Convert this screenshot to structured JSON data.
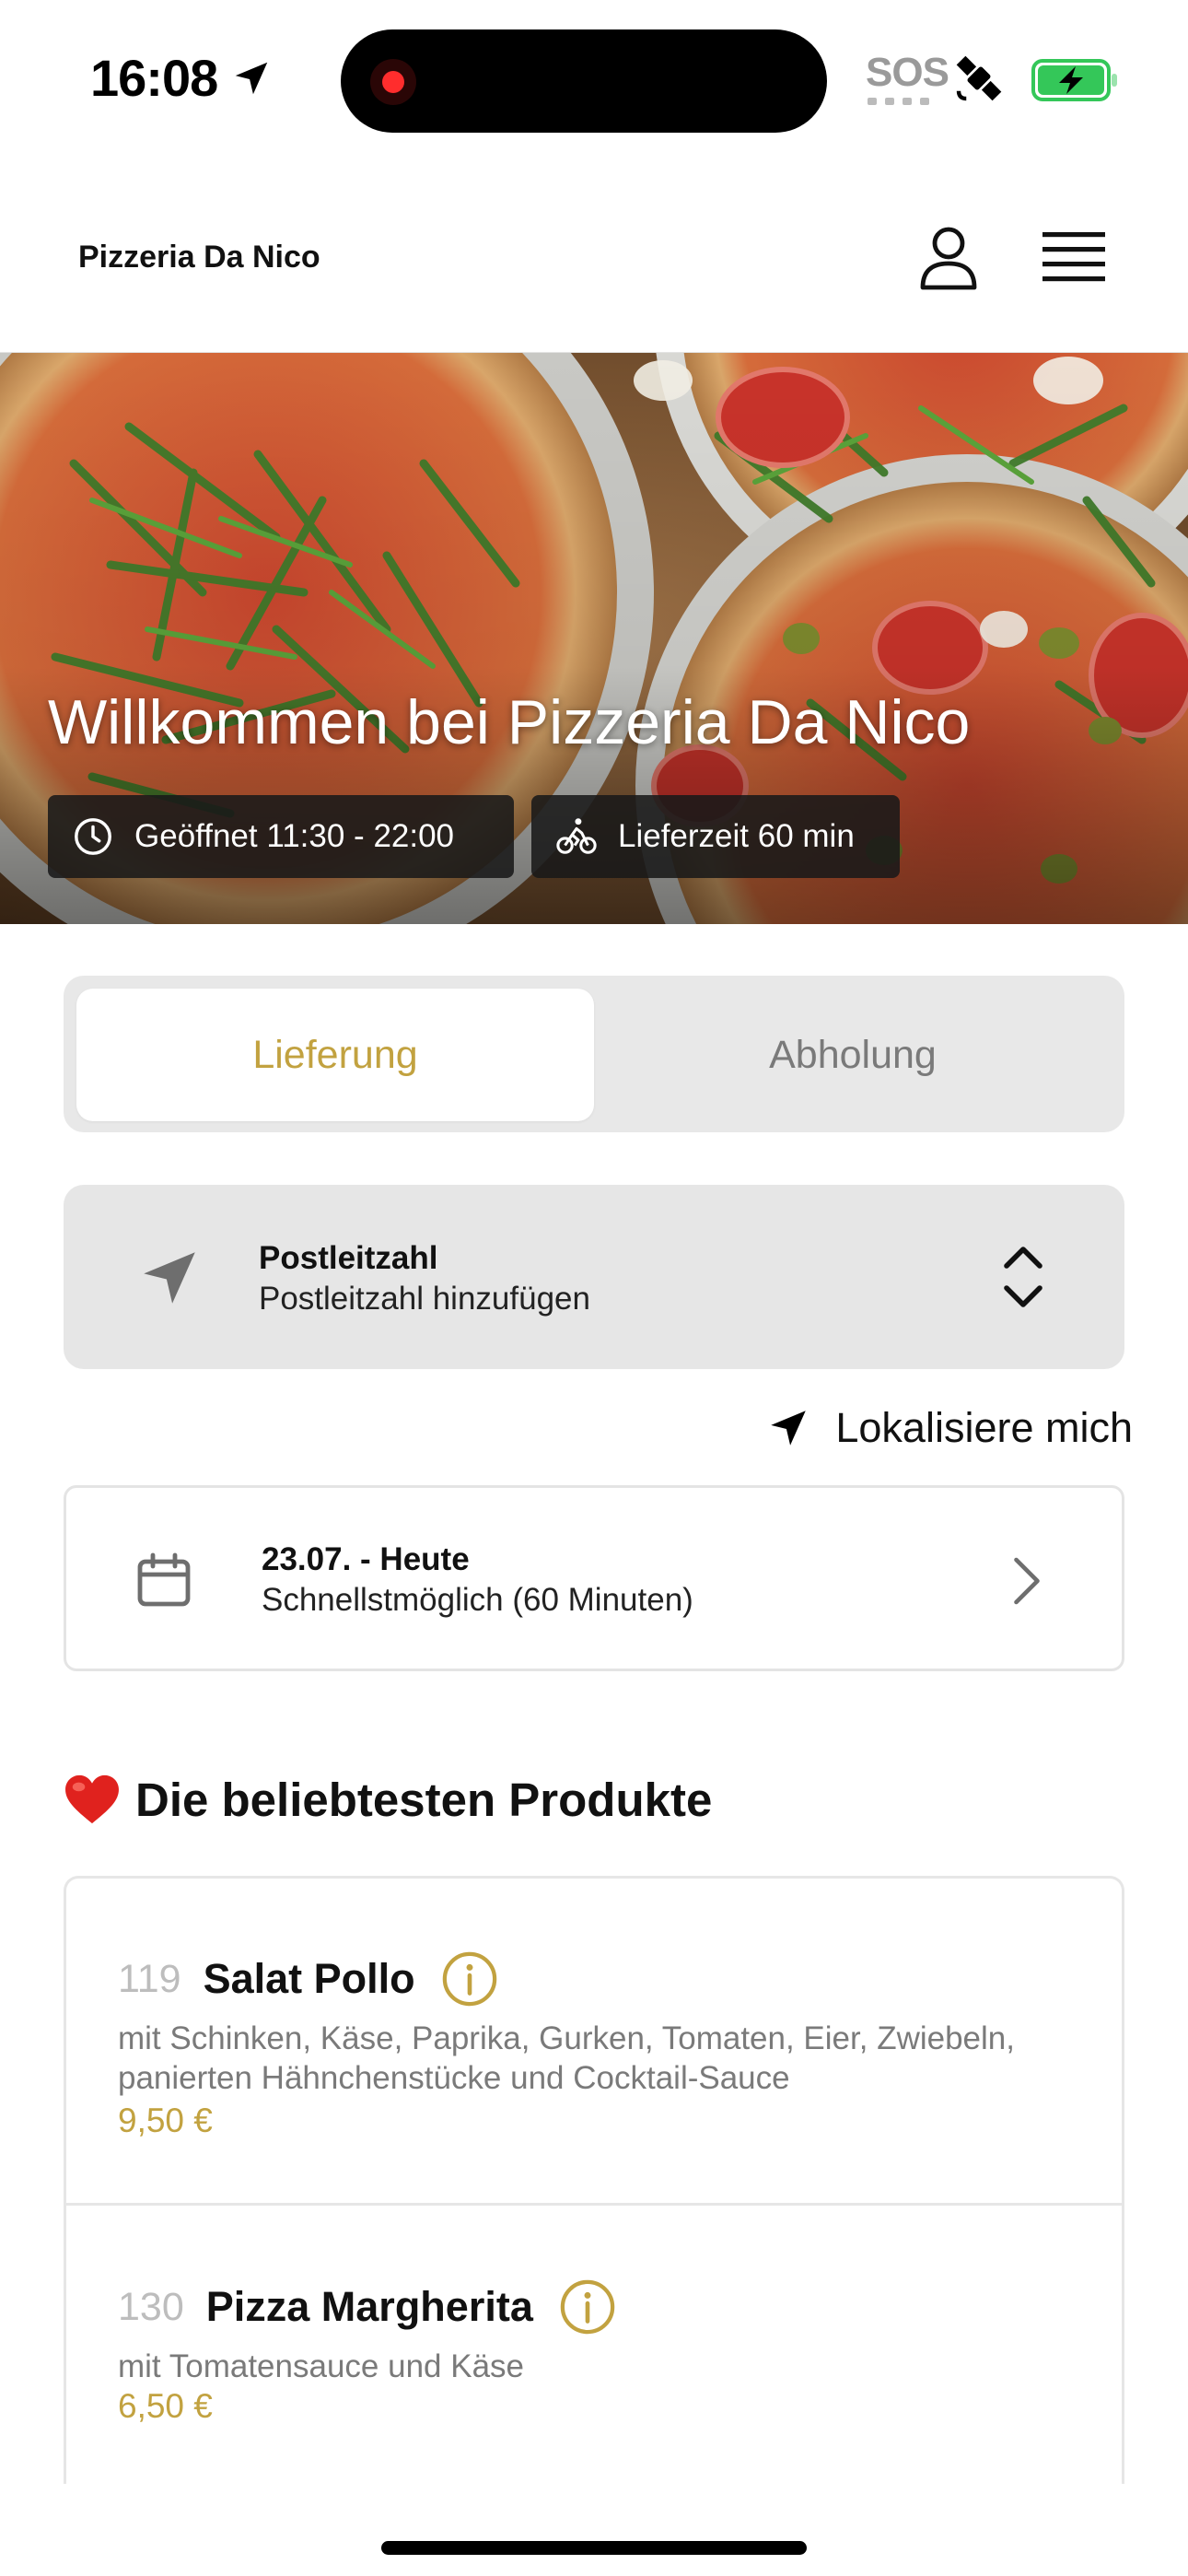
{
  "status_bar": {
    "time": "16:08",
    "sos": "SOS",
    "icons": [
      "location-arrow-icon",
      "recording-icon",
      "satellite-icon",
      "battery-charging-icon"
    ]
  },
  "header": {
    "brand": "Pizzeria Da Nico",
    "icons": [
      "user-icon",
      "menu-icon"
    ]
  },
  "hero": {
    "title": "Willkommen bei Pizzeria Da Nico",
    "opening_label": "Geöffnet 11:30 - 22:00",
    "delivery_time_label": "Lieferzeit 60 min",
    "icons": [
      "clock-icon",
      "bicycle-icon"
    ]
  },
  "order_mode": {
    "options": [
      "Lieferung",
      "Abholung"
    ],
    "selected": "Lieferung"
  },
  "postcode": {
    "title": "Postleitzahl",
    "placeholder": "Postleitzahl hinzufügen",
    "icons": [
      "navigation-arrow-icon",
      "chevron-up-down-icon"
    ]
  },
  "locate": {
    "label": "Lokalisiere mich",
    "icon": "navigation-arrow-icon"
  },
  "date": {
    "title": "23.07. - Heute",
    "subtitle": "Schnellstmöglich (60 Minuten)",
    "icons": [
      "calendar-icon",
      "chevron-right-icon"
    ]
  },
  "popular": {
    "heading": "Die beliebtesten Produkte",
    "icon": "heart-icon",
    "products": [
      {
        "number": "119",
        "name": "Salat Pollo",
        "description": "mit Schinken, Käse, Paprika, Gurken, Tomaten, Eier, Zwiebeln, panierten Hähnchenstücke und Cocktail-Sauce",
        "price": "9,50 €"
      },
      {
        "number": "130",
        "name": "Pizza Margherita",
        "description": "mit Tomatensauce und Käse",
        "price": "6,50 €"
      }
    ]
  },
  "colors": {
    "accent": "#c2a240",
    "panel": "#e6e6e6",
    "pill": "#191919"
  }
}
